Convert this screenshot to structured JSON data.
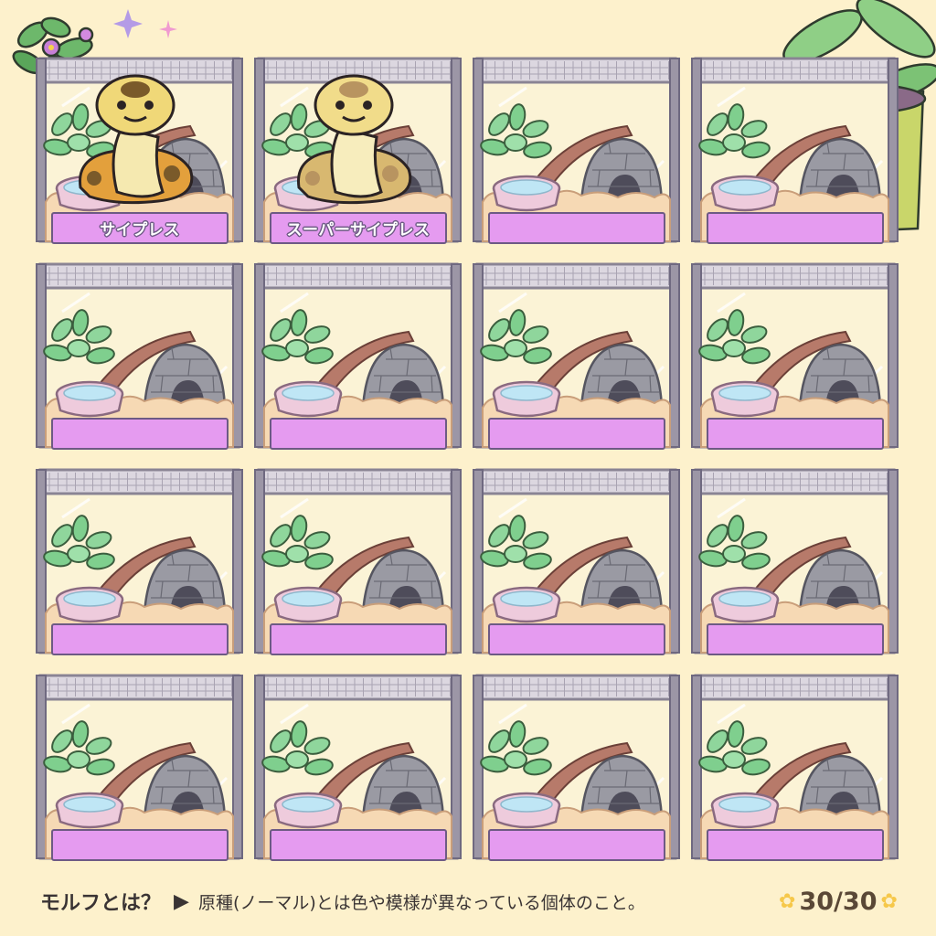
{
  "tanks": [
    {
      "label": "サイプレス",
      "has_snake": true,
      "morph": "cypress"
    },
    {
      "label": "スーパーサイプレス",
      "has_snake": true,
      "morph": "super-cypress"
    },
    {
      "label": "",
      "has_snake": false
    },
    {
      "label": "",
      "has_snake": false
    },
    {
      "label": "",
      "has_snake": false
    },
    {
      "label": "",
      "has_snake": false
    },
    {
      "label": "",
      "has_snake": false
    },
    {
      "label": "",
      "has_snake": false
    },
    {
      "label": "",
      "has_snake": false
    },
    {
      "label": "",
      "has_snake": false
    },
    {
      "label": "",
      "has_snake": false
    },
    {
      "label": "",
      "has_snake": false
    },
    {
      "label": "",
      "has_snake": false
    },
    {
      "label": "",
      "has_snake": false
    },
    {
      "label": "",
      "has_snake": false
    },
    {
      "label": "",
      "has_snake": false
    }
  ],
  "footer": {
    "question": "モルフとは？",
    "arrow": "▶",
    "explanation": "原種(ノーマル)とは色や模様が異なっている個体のこと。"
  },
  "counter": {
    "text": "30/30",
    "flower_icon": "✿"
  },
  "colors": {
    "background": "#fdf1cc",
    "frame": "#8a8494",
    "label": "#e59bf0",
    "substrate": "#f6d9b4",
    "plant": "#7fcf8e",
    "rock": "#9a9aa3"
  }
}
